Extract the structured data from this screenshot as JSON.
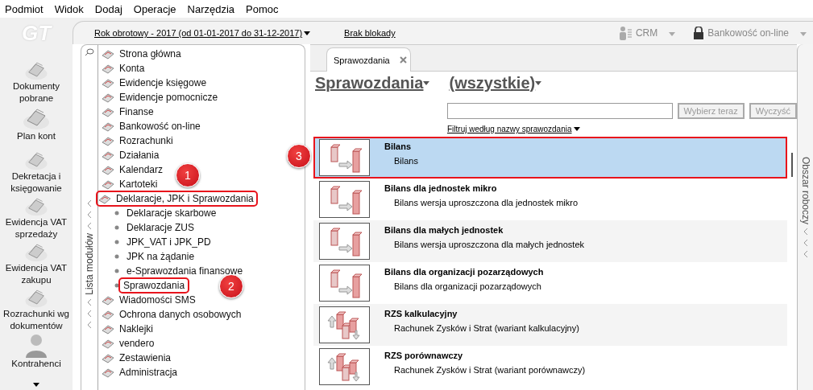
{
  "menu": [
    "Podmiot",
    "Widok",
    "Dodaj",
    "Operacje",
    "Narzędzia",
    "Pomoc"
  ],
  "header": {
    "logo": "GT",
    "fiscal_year": "Rok obrotowy - 2017  (od 01-01-2017 do 31-12-2017)",
    "lock": "Brak blokady",
    "crm": "CRM",
    "banking": "Bankowość on-line"
  },
  "toolbar": [
    {
      "label": "Dokumenty pobrane",
      "kind": "document"
    },
    {
      "label": "Plan kont",
      "kind": "document"
    },
    {
      "label": "Dekretacja i księgowanie",
      "kind": "document"
    },
    {
      "label": "Ewidencja VAT sprzedaży",
      "kind": "document"
    },
    {
      "label": "Ewidencja VAT zakupu",
      "kind": "document"
    },
    {
      "label": "Rozrachunki wg dokumentów",
      "kind": "document"
    },
    {
      "label": "Kontrahenci",
      "kind": "person"
    }
  ],
  "modules": {
    "title": "Lista modułów",
    "items": [
      {
        "label": "Strona główna",
        "outlined": false
      },
      {
        "label": "Konta",
        "outlined": false
      },
      {
        "label": "Ewidencje księgowe",
        "outlined": false
      },
      {
        "label": "Ewidencje pomocnicze",
        "outlined": false
      },
      {
        "label": "Finanse",
        "outlined": false
      },
      {
        "label": "Bankowość on-line",
        "outlined": false
      },
      {
        "label": "Rozrachunki",
        "outlined": false
      },
      {
        "label": "Działania",
        "outlined": false
      },
      {
        "label": "Kalendarz",
        "outlined": false,
        "callout": "1"
      },
      {
        "label": "Kartoteki",
        "outlined": false
      },
      {
        "label": "Deklaracje, JPK i Sprawozdania",
        "outlined": true,
        "children": [
          {
            "label": "Deklaracje skarbowe",
            "outlined": false
          },
          {
            "label": "Deklaracje ZUS",
            "outlined": false
          },
          {
            "label": "JPK_VAT i JPK_PD",
            "outlined": false
          },
          {
            "label": "JPK na żądanie",
            "outlined": false
          },
          {
            "label": "e-Sprawozdania finansowe",
            "outlined": false
          },
          {
            "label": "Sprawozdania",
            "outlined": true,
            "callout": "2"
          }
        ]
      },
      {
        "label": "Wiadomości SMS",
        "outlined": false
      },
      {
        "label": "Ochrona danych osobowych",
        "outlined": false
      },
      {
        "label": "Naklejki",
        "outlined": false
      },
      {
        "label": "vendero",
        "outlined": false
      },
      {
        "label": "Zestawienia",
        "outlined": false
      },
      {
        "label": "Administracja",
        "outlined": false
      }
    ]
  },
  "tab": {
    "label": "Sprawozdania",
    "selected": true
  },
  "heading": {
    "category": "Sprawozdania",
    "filter": "(wszystkie)"
  },
  "search": {
    "select_button": "Wybierz teraz",
    "clear_button": "Wyczyść",
    "filter_link": "Filtruj według nazwy sprawozdania"
  },
  "reports": [
    {
      "title": "Bilans",
      "subtitle": "Bilans",
      "kind": "bilans",
      "selected": true,
      "outlined": true,
      "callout": "3"
    },
    {
      "title": "Bilans dla jednostek mikro",
      "subtitle": "Bilans wersja uproszczona dla jednostek mikro",
      "kind": "bilans",
      "selected": false,
      "outlined": false
    },
    {
      "title": "Bilans dla małych jednostek",
      "subtitle": "Bilans wersja uproszczona dla małych jednostek",
      "kind": "bilans",
      "selected": false,
      "outlined": false
    },
    {
      "title": "Bilans dla organizacji pozarządowych",
      "subtitle": "Bilans dla organizacji pozarządowych",
      "kind": "bilans",
      "selected": false,
      "outlined": false
    },
    {
      "title": "RZS kalkulacyjny",
      "subtitle": "Rachunek Zysków i Strat (wariant kalkulacyjny)",
      "kind": "rzs",
      "selected": false,
      "outlined": false
    },
    {
      "title": "RZS porównawczy",
      "subtitle": "Rachunek Zysków i Strat (wariant porównawczy)",
      "kind": "rzs",
      "selected": false,
      "outlined": false
    }
  ],
  "workspace": {
    "title": "Obszar roboczy"
  }
}
